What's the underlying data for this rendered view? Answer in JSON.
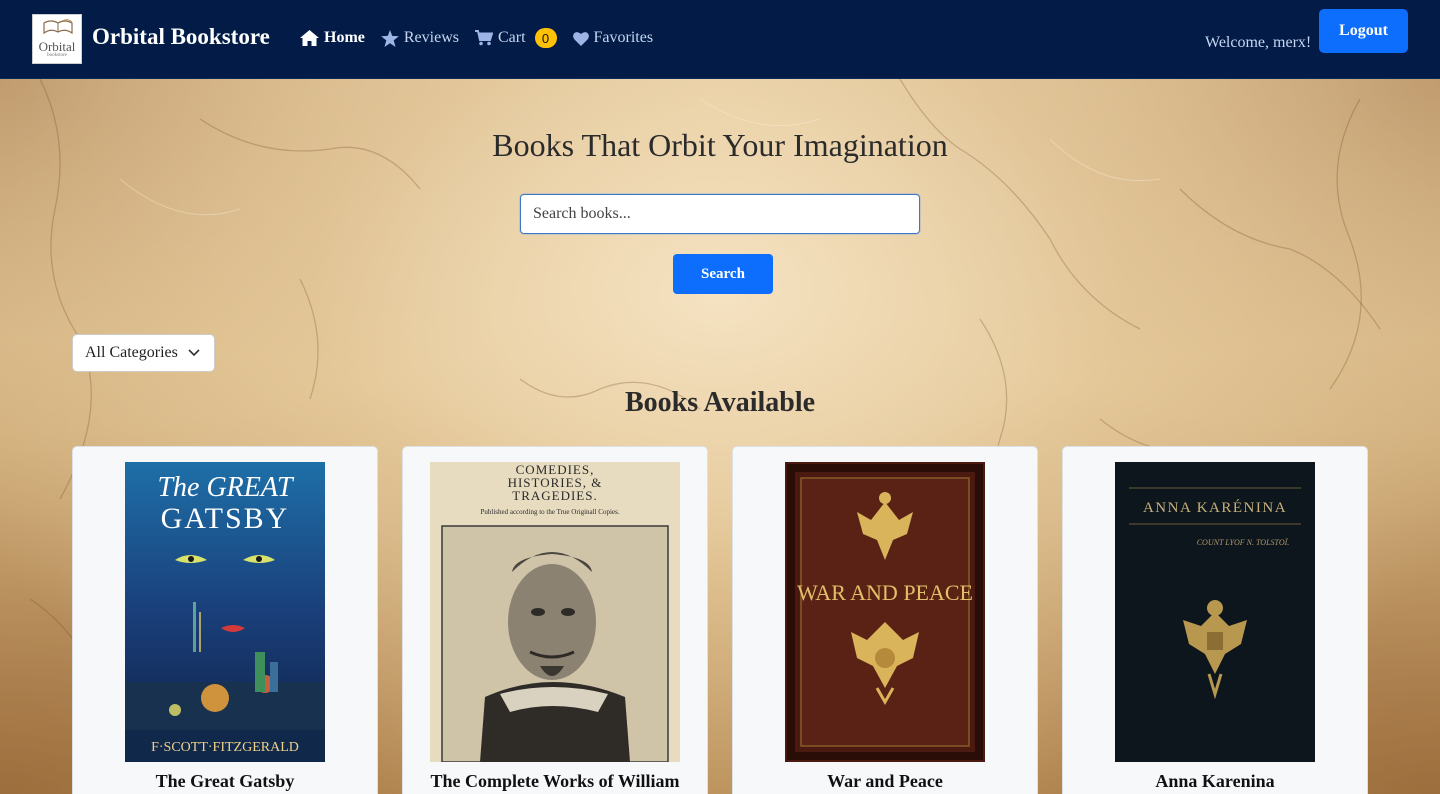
{
  "nav": {
    "brand": "Orbital Bookstore",
    "logo_word": "Orbital",
    "logo_sub": "bookstore",
    "links": [
      {
        "label": "Home",
        "icon": "home-icon",
        "active": true
      },
      {
        "label": "Reviews",
        "icon": "star-icon",
        "active": false
      },
      {
        "label": "Cart",
        "icon": "cart-icon",
        "active": false
      },
      {
        "label": "Favorites",
        "icon": "heart-icon",
        "active": false
      }
    ],
    "cart_count": "0",
    "welcome": "Welcome, merx!",
    "logout": "Logout"
  },
  "hero": {
    "title": "Books That Orbit Your Imagination",
    "search_placeholder": "Search books...",
    "search_button": "Search"
  },
  "filter": {
    "selected": "All Categories"
  },
  "books_section": {
    "title": "Books Available",
    "books": [
      {
        "title": "The Great Gatsby",
        "cover_text": [
          "The GREAT",
          "GATSBY",
          "F·SCOTT·FITZGERALD"
        ]
      },
      {
        "title": "The Complete Works of William",
        "cover_text": [
          "COMEDIES,",
          "HISTORIES, &",
          "TRAGEDIES.",
          "Published according to the True Originall Copies."
        ]
      },
      {
        "title": "War and Peace",
        "cover_text": [
          "WAR AND PEACE"
        ]
      },
      {
        "title": "Anna Karenina",
        "cover_text": [
          "ANNA KARÉNINA",
          "COUNT LYOF N. TOLSTOÏ."
        ]
      }
    ]
  },
  "colors": {
    "navbar": "#021c47",
    "primary": "#0d6efd",
    "badge": "#ffc107",
    "parchment": "#e7cda0"
  }
}
